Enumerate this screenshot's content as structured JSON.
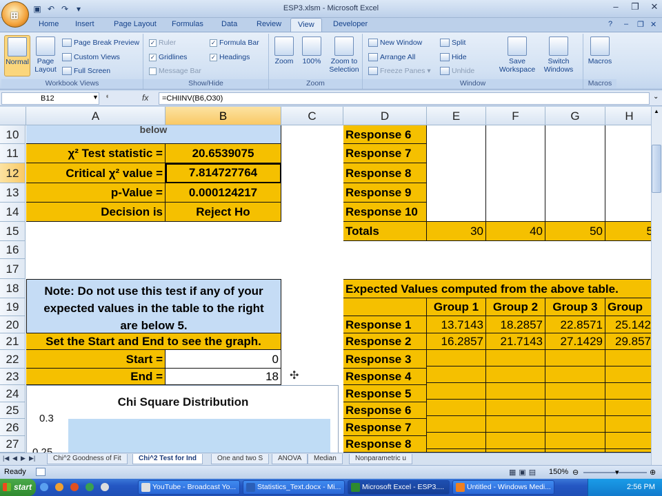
{
  "window": {
    "doc_title": "ESP3.xlsm - Microsoft Excel"
  },
  "ribbon": {
    "tabs": [
      "Home",
      "Insert",
      "Page Layout",
      "Formulas",
      "Data",
      "Review",
      "View",
      "Developer"
    ],
    "active_tab": "View",
    "groups": {
      "workbook_views": {
        "label": "Workbook Views",
        "normal": "Normal",
        "page_layout": "Page Layout",
        "page_break_preview": "Page Break Preview",
        "custom_views": "Custom Views",
        "full_screen": "Full Screen"
      },
      "show_hide": {
        "label": "Show/Hide",
        "ruler": "Ruler",
        "gridlines": "Gridlines",
        "message_bar": "Message Bar",
        "formula_bar": "Formula Bar",
        "headings": "Headings"
      },
      "zoom": {
        "label": "Zoom",
        "zoom": "Zoom",
        "zoom100": "100%",
        "zoom_to_selection": "Zoom to Selection"
      },
      "window": {
        "label": "Window",
        "new_window": "New Window",
        "arrange_all": "Arrange All",
        "freeze_panes": "Freeze Panes",
        "split": "Split",
        "hide": "Hide",
        "unhide": "Unhide",
        "save_workspace": "Save Workspace",
        "switch_windows": "Switch Windows"
      },
      "macros": {
        "label": "Macros",
        "macros": "Macros"
      }
    }
  },
  "formula_bar": {
    "name_box": "B12",
    "fx": "fx",
    "formula": "=CHIINV(B6,O30)"
  },
  "columns": [
    "A",
    "B",
    "C",
    "D",
    "E",
    "F",
    "G",
    "H"
  ],
  "rows": [
    "10",
    "11",
    "12",
    "13",
    "14",
    "15",
    "16",
    "17",
    "18",
    "19",
    "20",
    "21",
    "22",
    "23",
    "24",
    "25",
    "26",
    "27"
  ],
  "cells": {
    "a10": "below",
    "a11": "χ² Test statistic =",
    "b11": "20.6539075",
    "a12": "Critical χ² value =",
    "b12": "7.814727764",
    "a13": "p-Value =",
    "b13": "0.000124217",
    "a14": "Decision is",
    "b14": "Reject Ho",
    "note1": "Note: Do not use this test if any of your",
    "note2": "expected values in the table to the right",
    "note3": "are below 5.",
    "a21": "Set the Start and End to see the graph.",
    "a22": "Start =",
    "b22": "0",
    "a23": "End =",
    "b23": "18",
    "d10": "Response 6",
    "d11": "Response 7",
    "d12": "Response 8",
    "d13": "Response 9",
    "d14": "Response 10",
    "d15": "Totals",
    "e15": "30",
    "f15": "40",
    "g15": "50",
    "h15": "5",
    "d18": "Expected Values computed from the above table.",
    "e19": "Group 1",
    "f19": "Group 2",
    "g19": "Group 3",
    "h19": "Group",
    "d20": "Response 1",
    "e20": "13.7143",
    "f20": "18.2857",
    "g20": "22.8571",
    "h20": "25.142",
    "d21": "Response 2",
    "e21": "16.2857",
    "f21": "21.7143",
    "g21": "27.1429",
    "h21": "29.857",
    "d22": "Response 3",
    "d23": "Response 4",
    "d24": "Response 5",
    "d25": "Response 6",
    "d26": "Response 7",
    "d27": "Response 8"
  },
  "chart": {
    "title": "Chi Square Distribution",
    "y_ticks": [
      "0.3",
      "0.25"
    ]
  },
  "chart_data": {
    "type": "area",
    "title": "Chi Square Distribution",
    "yticks": [
      "0.3",
      "0.25"
    ],
    "x": [],
    "values": []
  },
  "sheet_tabs": [
    "Chi^2 Goodness of Fit",
    "Chi^2 Test for Ind",
    "One and two S",
    "ANOVA",
    "Median",
    "Nonparametric u"
  ],
  "active_sheet": "Chi^2 Test for Ind",
  "status": {
    "ready": "Ready",
    "zoom": "150%"
  },
  "taskbar": {
    "start": "start",
    "items": [
      "YouTube - Broadcast Yo...",
      "Statistics_Text.docx - Mi...",
      "Microsoft Excel - ESP3....",
      "Untitled - Windows Medi..."
    ],
    "active_index": 2,
    "time": "2:56 PM"
  }
}
